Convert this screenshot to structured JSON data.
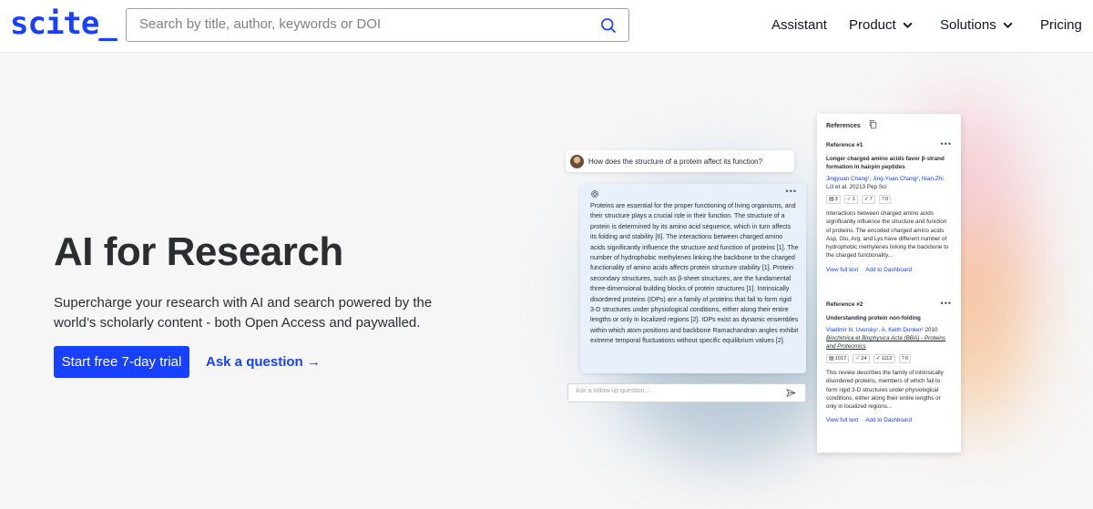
{
  "header": {
    "logo": "scite_",
    "search_placeholder": "Search by title, author, keywords or DOI",
    "nav": [
      "Assistant",
      "Product",
      "Solutions",
      "Pricing"
    ]
  },
  "hero": {
    "title": "AI for Research",
    "subtitle": "Supercharge your research with AI and search powered by the world’s scholarly content - both Open Access and paywalled.",
    "cta_primary": "Start free 7-day trial",
    "cta_secondary": "Ask a question →"
  },
  "chat": {
    "question": "How does the structure of a protein affect its function?",
    "answer": "Proteins are essential for the proper functioning of living organisms, and their structure plays a crucial role in their function. The structure of a protein is determined by its amino acid sequence, which in turn affects its folding and stability [6]. The interactions between charged amino acids significantly influence the structure and function of proteins [1]. The number of hydrophobic methylenes linking the backbone to the charged functionality of amino acids affects protein structure stability [1]. Protein secondary structures, such as β-sheet structures, are the fundamental three-dimensional building blocks of protein structures [1]. Intrinsically disordered proteins (IDPs) are a family of proteins that fail to form rigid 3-D structures under physiological conditions, either along their entire lengths or only in localized regions [2]. IDPs exist as dynamic ensembles within which atom positions and backbone Ramachandran angles exhibit extreme temporal fluctuations without specific equilibrium values [2].",
    "followup_placeholder": "Ask a follow up question..."
  },
  "references": {
    "title": "References",
    "items": [
      {
        "label": "Reference #1",
        "title": "Longer charged amino acids favor β-strand formation in hairpin peptides",
        "authors": "Jingyuan Chang¹, Jing-Yuan Chang², Nian-Zhi Li3",
        "suffix": " et al. 20213 Pep Sci",
        "journal": "",
        "badges": [
          "3",
          "1",
          "7",
          "0"
        ],
        "abstract": "Interactions between charged amino acids significantly influence the structure and function of proteins. The encoded charged amino acids Asp, Glu, Arg, and Lys have different number of hydrophobic methylenes linking the backbone to the charged functionality...",
        "link1": "View full text",
        "link2": "Add to Dashboard"
      },
      {
        "label": "Reference #2",
        "title": "Understanding protein non-folding",
        "authors": "Vladimir N. Uversky¹, A. Keith Dunker²",
        "suffix": " 2010",
        "journal": "Biochimica et Biophysica Acta (BBA) - Proteins and Proteomics",
        "badges": [
          "1017",
          "24",
          "1112",
          "0"
        ],
        "abstract": "This review describes the family of intrinsically disordered proteins, members of which fail to form rigid 3-D structures under physiological conditions, either along their entire lengths or only in localized regions...",
        "link1": "View full text",
        "link2": "Add to Dashboard"
      }
    ]
  },
  "colors": {
    "brand": "#1741ff",
    "answer_bg": "#e8f0fb"
  }
}
